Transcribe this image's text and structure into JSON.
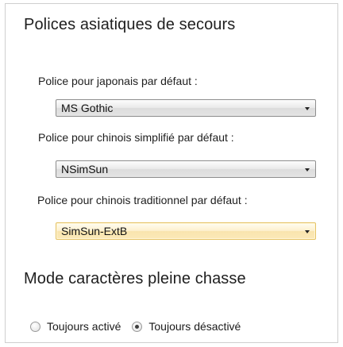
{
  "asian_fonts": {
    "title": "Polices asiatiques de secours",
    "japanese": {
      "label": "Police pour japonais par défaut :",
      "selected": "MS Gothic"
    },
    "simplified_chinese": {
      "label": "Police pour chinois simplifié par défaut :",
      "selected": "NSimSun"
    },
    "traditional_chinese": {
      "label": "Police pour chinois traditionnel par défaut :",
      "selected": "SimSun-ExtB"
    }
  },
  "fullwidth_mode": {
    "title": "Mode caractères pleine chasse",
    "options": [
      {
        "label": "Toujours activé",
        "checked": false
      },
      {
        "label": "Toujours désactivé",
        "checked": true
      }
    ]
  },
  "colors": {
    "focused_combo_border": "#e5c365",
    "focused_combo_fill": "#fdf0cd",
    "frame_border": "#cfcfcf"
  }
}
